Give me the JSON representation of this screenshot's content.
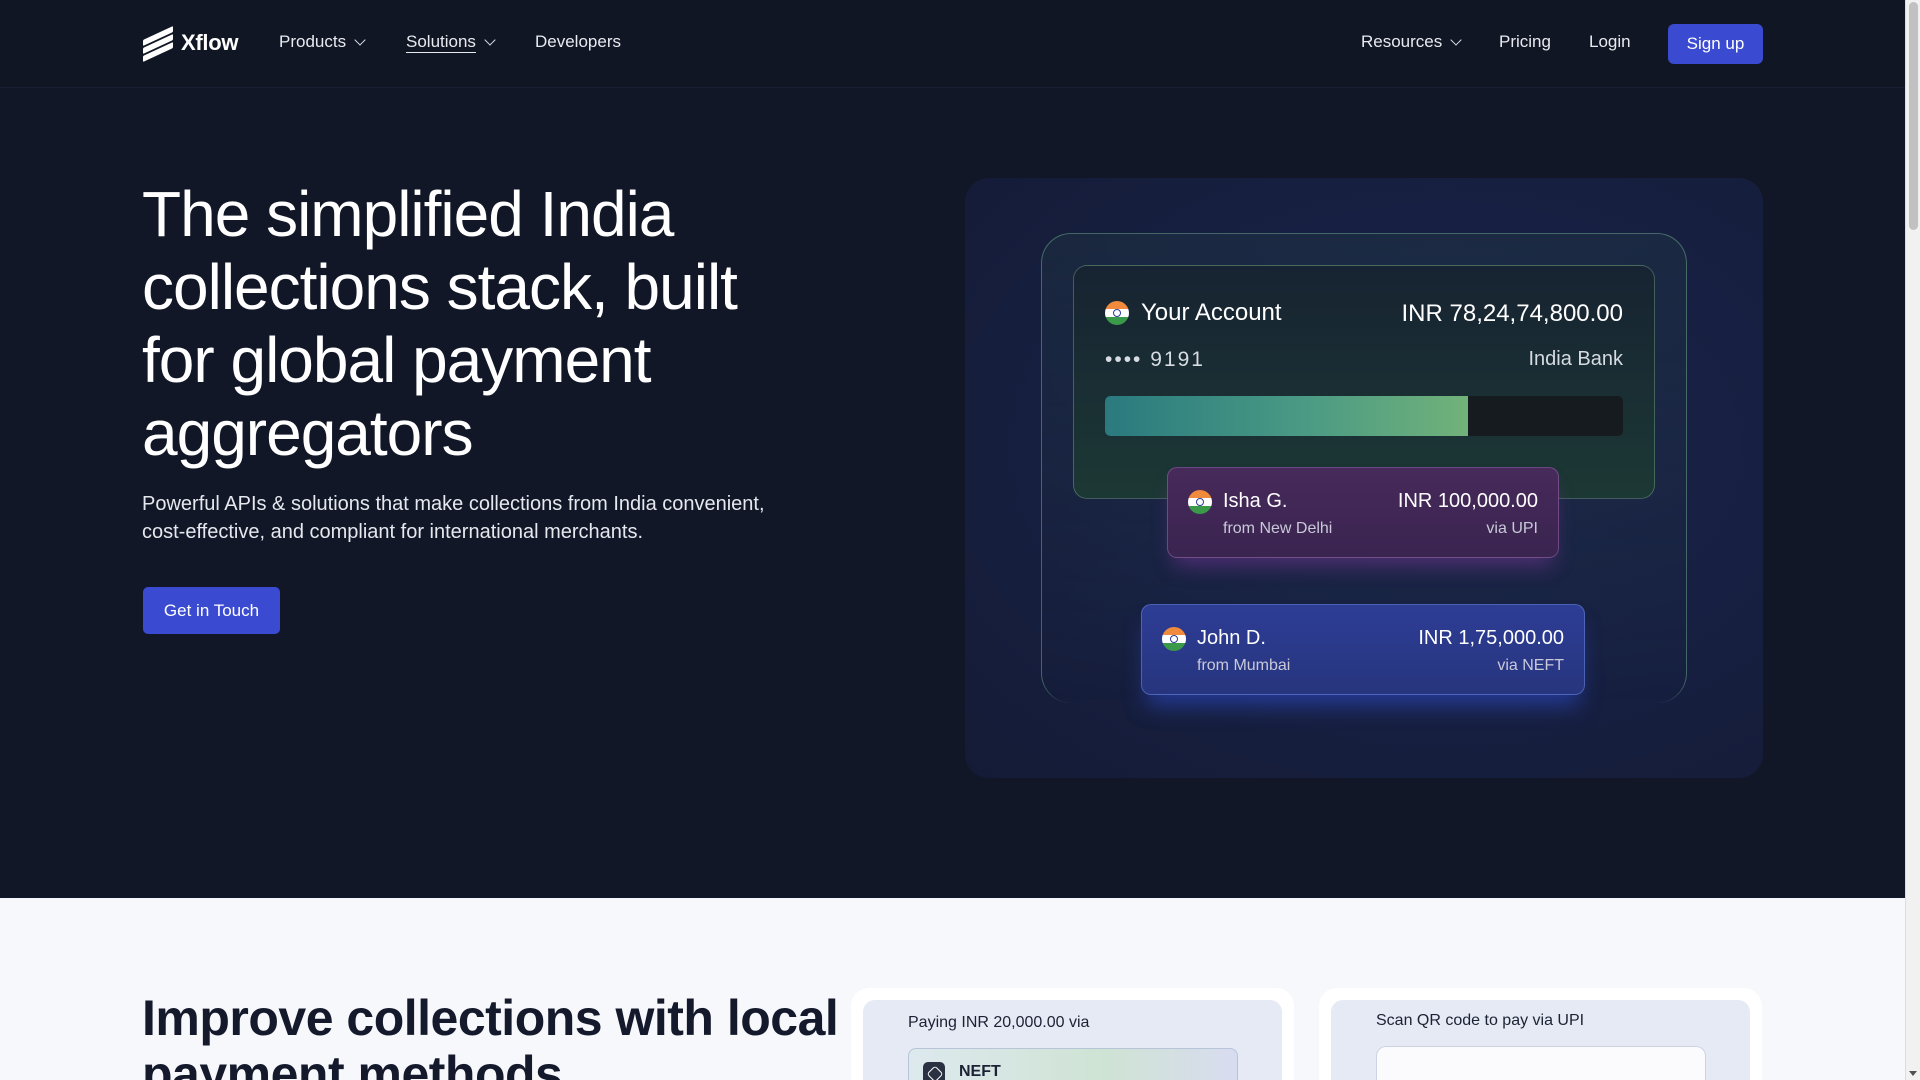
{
  "header": {
    "logo_text": "Xflow",
    "nav_left": {
      "products": "Products",
      "solutions": "Solutions",
      "developers": "Developers"
    },
    "nav_right": {
      "resources": "Resources",
      "pricing": "Pricing",
      "login": "Login",
      "signup": "Sign up"
    }
  },
  "hero": {
    "title": "The simplified India collections stack, built for global payment aggregators",
    "subtitle": "Powerful APIs & solutions that make collections from India convenient, cost-effective, and compliant for international merchants.",
    "cta": "Get in Touch"
  },
  "illustration": {
    "account": {
      "title": "Your Account",
      "amount": "INR 78,24,74,800.00",
      "number": "•••• 9191",
      "bank": "India Bank",
      "progress_fraction": 0.7
    },
    "payments": [
      {
        "name": "Isha G.",
        "from": "from New Delhi",
        "amount": "INR 100,000.00",
        "via": "via UPI",
        "flag_icon": "india-flag-icon"
      },
      {
        "name": "John D.",
        "from": "from Mumbai",
        "amount": "INR 1,75,000.00",
        "via": "via NEFT",
        "flag_icon": "india-flag-icon"
      }
    ]
  },
  "lower": {
    "title": "Improve collections with local payment methods",
    "neft_card": {
      "label": "Paying INR 20,000.00 via",
      "method": "NEFT"
    },
    "qr_card": {
      "label": "Scan QR code to pay via UPI"
    }
  },
  "colors": {
    "background": "#111727",
    "accent": "#3a4bd1",
    "lower_background": "#f7f8fb"
  }
}
